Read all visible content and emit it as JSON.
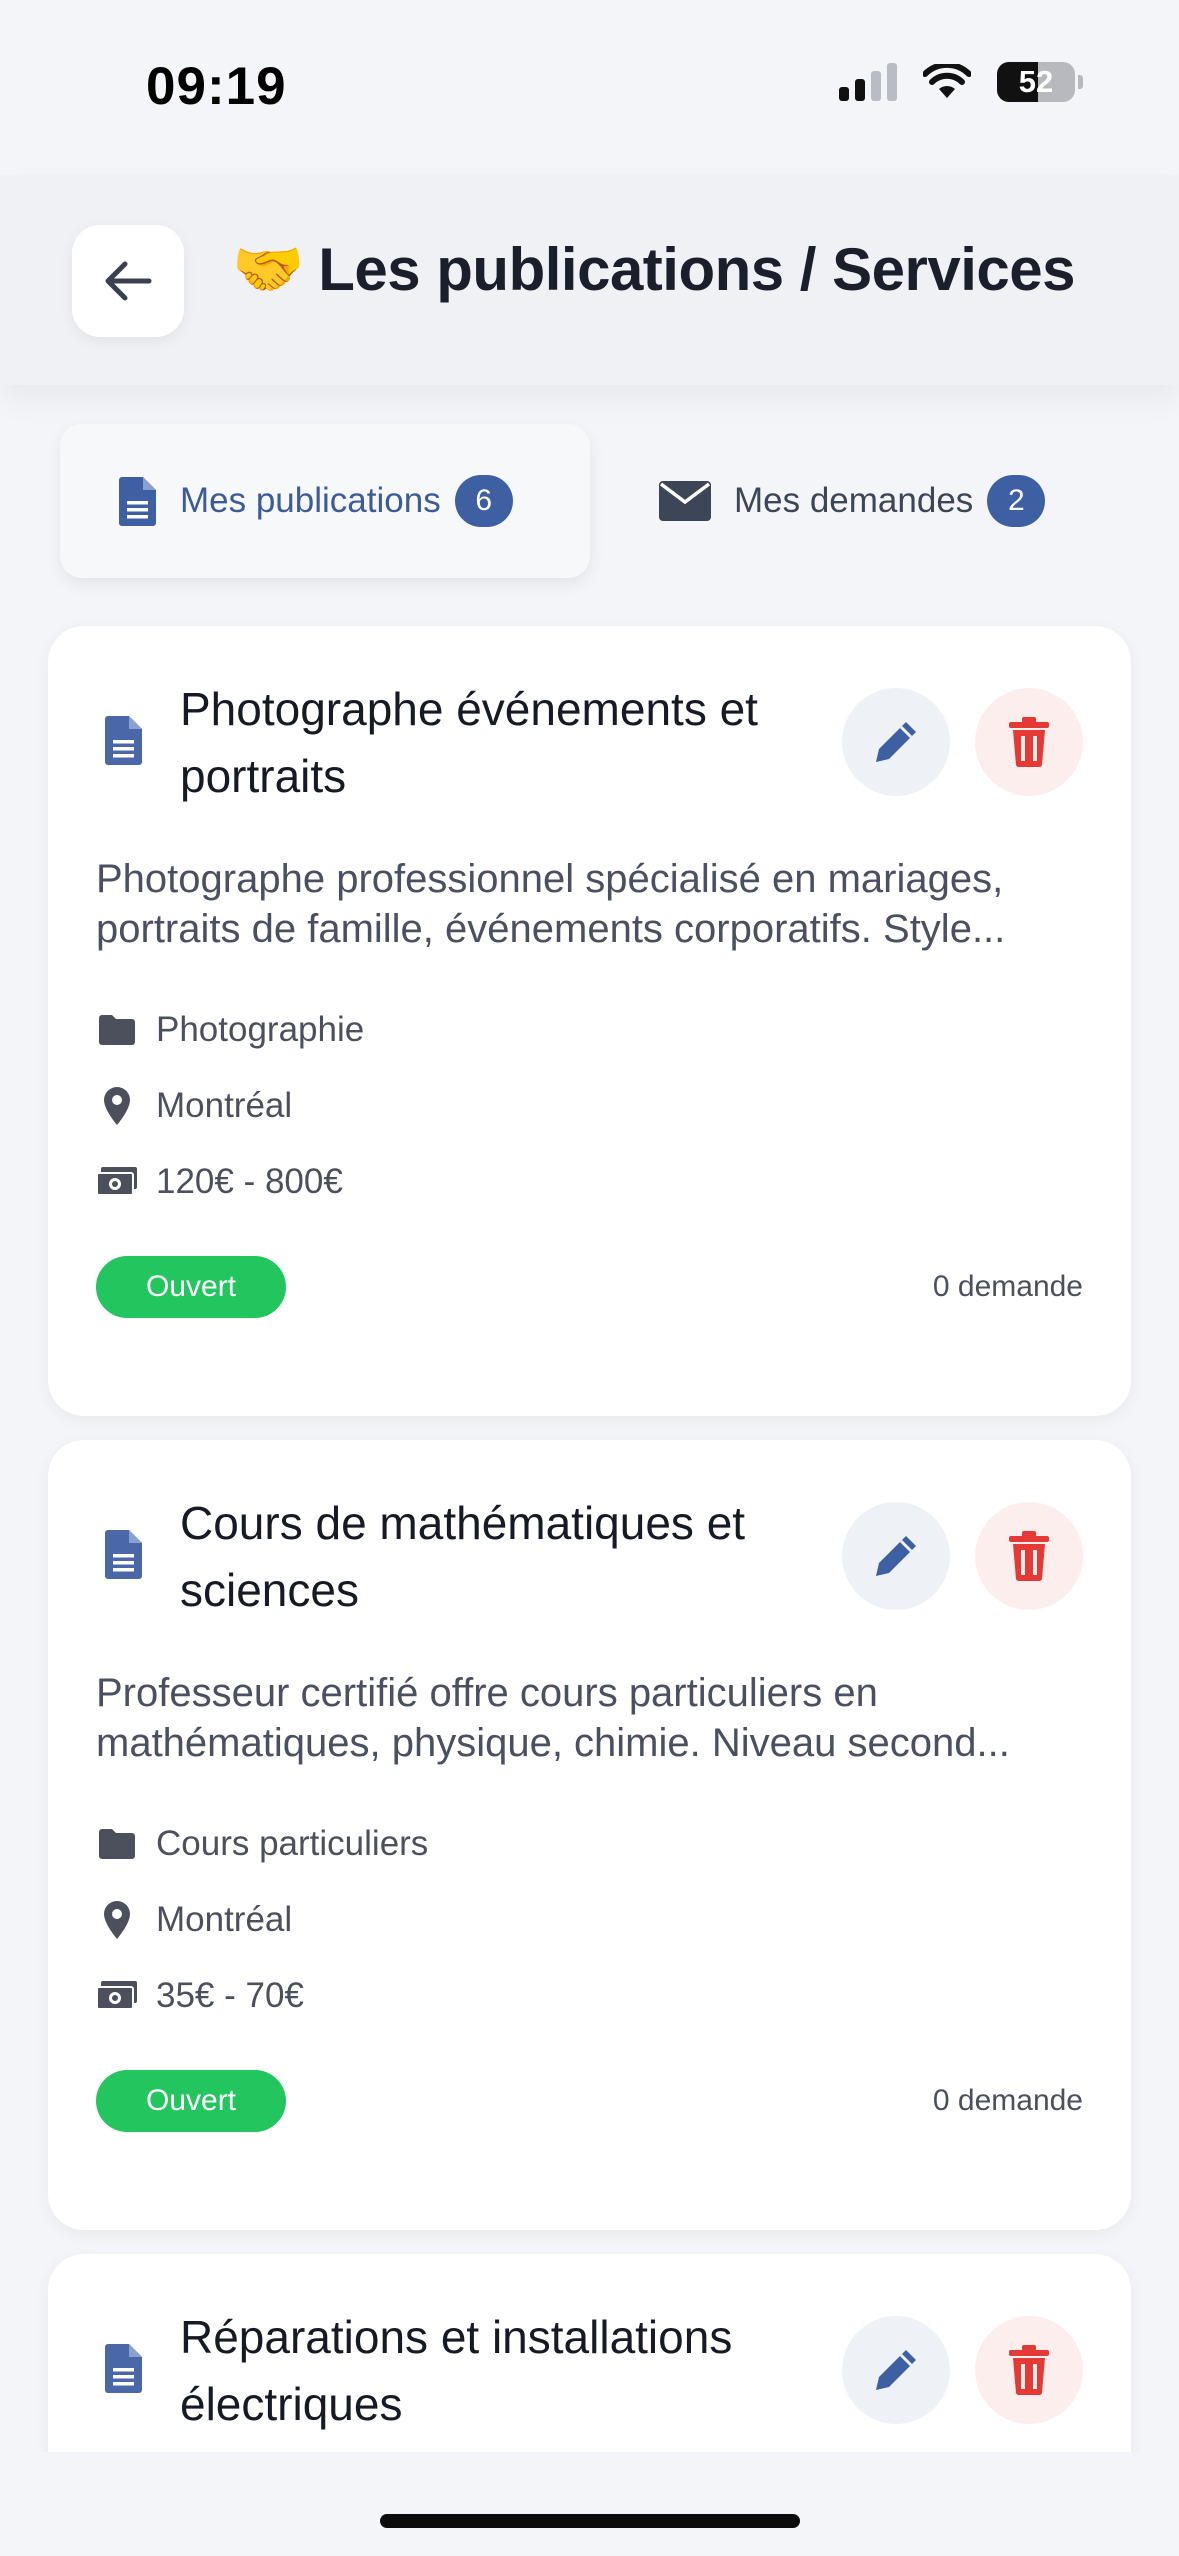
{
  "status_bar": {
    "time": "09:19",
    "battery": "52",
    "battery_level": 0.52
  },
  "header": {
    "emoji": "🤝",
    "title": "Les publications / Services"
  },
  "tabs": [
    {
      "label": "Mes publications",
      "count": "6",
      "icon": "document-icon",
      "active": true
    },
    {
      "label": "Mes demandes",
      "count": "2",
      "icon": "envelope-icon",
      "active": false
    }
  ],
  "cards": [
    {
      "title_lines": [
        "Photographe événements et",
        "portraits"
      ],
      "description_lines": [
        "Photographe professionnel spécialisé en mariages,",
        "portraits de famille, événements corporatifs. Style..."
      ],
      "category": "Photographie",
      "location": "Montréal",
      "price": "120€ - 800€",
      "status": "Ouvert",
      "requests": "0 demande"
    },
    {
      "title_lines": [
        "Cours de mathématiques et",
        "sciences"
      ],
      "description_lines": [
        "Professeur certifié offre cours particuliers en",
        "mathématiques, physique, chimie. Niveau second..."
      ],
      "category": "Cours particuliers",
      "location": "Montréal",
      "price": "35€ - 70€",
      "status": "Ouvert",
      "requests": "0 demande"
    },
    {
      "title_lines": [
        "Réparations et installations",
        "électriques"
      ]
    }
  ],
  "colors": {
    "accent": "#3f5fa3",
    "status_open": "#22c55e",
    "delete": "#e53935"
  }
}
